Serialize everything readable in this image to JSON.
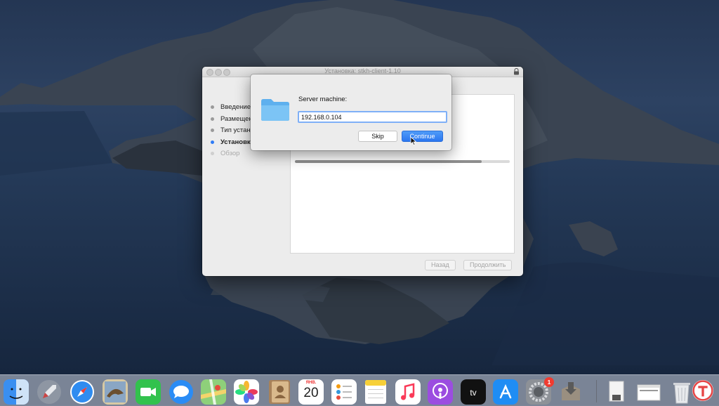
{
  "installer": {
    "title": "Установка: stkh-client-1.10",
    "steps": [
      {
        "label": "Введение",
        "state": "done"
      },
      {
        "label": "Размещен",
        "state": "done"
      },
      {
        "label": "Тип устан",
        "state": "done"
      },
      {
        "label": "Установк",
        "state": "active"
      },
      {
        "label": "Обзор",
        "state": "future"
      }
    ],
    "progress": 0.87,
    "back_label": "Назад",
    "continue_label": "Продолжить"
  },
  "dialog": {
    "label": "Server machine:",
    "input_value": "192.168.0.104",
    "skip_label": "Skip",
    "continue_label": "Continue"
  },
  "dock": {
    "calendar_month": "ЯНВ.",
    "calendar_day": "20",
    "settings_badge": "1"
  },
  "colors": {
    "accent": "#2f7cf6",
    "badge": "#f03b30"
  }
}
